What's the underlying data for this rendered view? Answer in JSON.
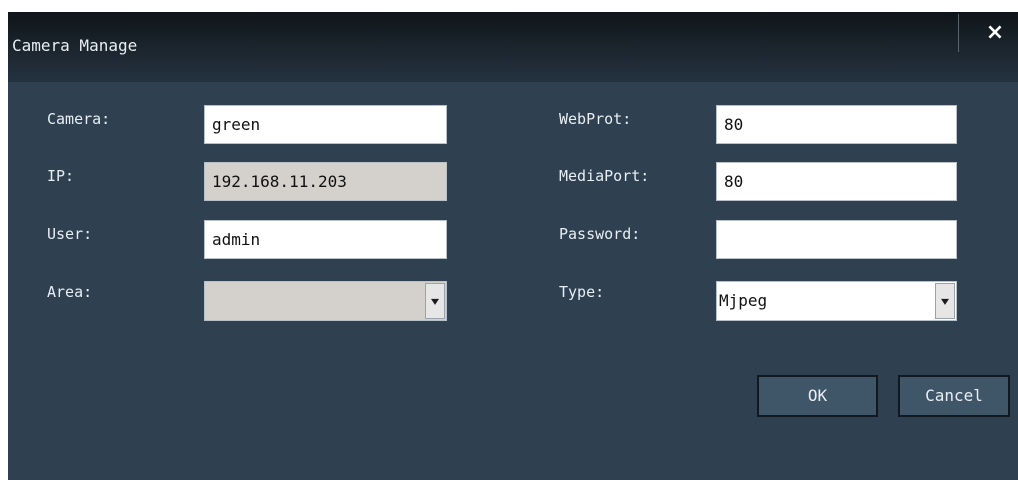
{
  "dialog": {
    "title": "Camera Manage",
    "close_label": "×"
  },
  "form": {
    "camera": {
      "label": "Camera:",
      "value": "green"
    },
    "ip": {
      "label": "IP:",
      "value": "192.168.11.203"
    },
    "user": {
      "label": "User:",
      "value": "admin"
    },
    "area": {
      "label": "Area:",
      "value": ""
    },
    "webport": {
      "label": "WebProt:",
      "value": "80"
    },
    "mediaport": {
      "label": "MediaPort:",
      "value": "80"
    },
    "password": {
      "label": "Password:",
      "value": ""
    },
    "type": {
      "label": "Type:",
      "value": "Mjpeg"
    }
  },
  "buttons": {
    "ok": "OK",
    "cancel": "Cancel"
  },
  "colors": {
    "background": "#2f4050",
    "titlebar": "#121a21",
    "button": "#3f5568",
    "disabled_field": "#d4d0cc"
  }
}
